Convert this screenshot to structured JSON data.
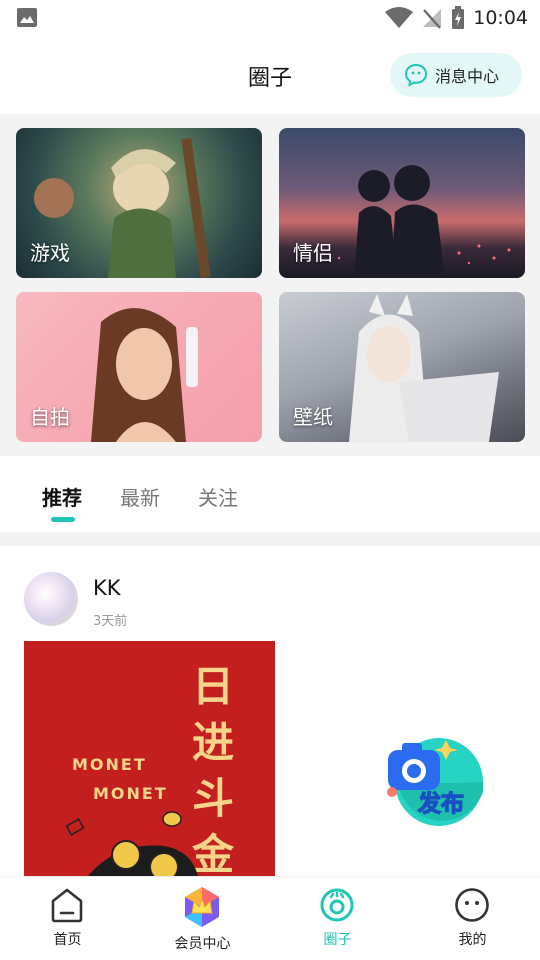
{
  "status_bar": {
    "time": "10:04"
  },
  "header": {
    "title": "圈子",
    "message_center_label": "消息中心"
  },
  "categories": [
    {
      "label": "游戏"
    },
    {
      "label": "情侣"
    },
    {
      "label": "自拍"
    },
    {
      "label": "壁纸"
    }
  ],
  "tabs": [
    {
      "label": "推荐",
      "active": true
    },
    {
      "label": "最新",
      "active": false
    },
    {
      "label": "关注",
      "active": false
    }
  ],
  "post": {
    "username": "KK",
    "time": "3天前",
    "image_text": {
      "line1": "MONET",
      "line2": "MONET",
      "chars": [
        "日",
        "进",
        "斗",
        "金"
      ]
    }
  },
  "fab": {
    "label": "发布"
  },
  "bottom_nav": [
    {
      "label": "首页",
      "icon": "home-icon",
      "active": false
    },
    {
      "label": "会员中心",
      "icon": "vip-crown-icon",
      "active": false
    },
    {
      "label": "圈子",
      "icon": "circle-icon",
      "active": true
    },
    {
      "label": "我的",
      "icon": "profile-face-icon",
      "active": false
    }
  ],
  "colors": {
    "accent": "#1fc6b4",
    "message_btn_bg": "#e3f8f6",
    "post_bg": "#c21f1e"
  }
}
